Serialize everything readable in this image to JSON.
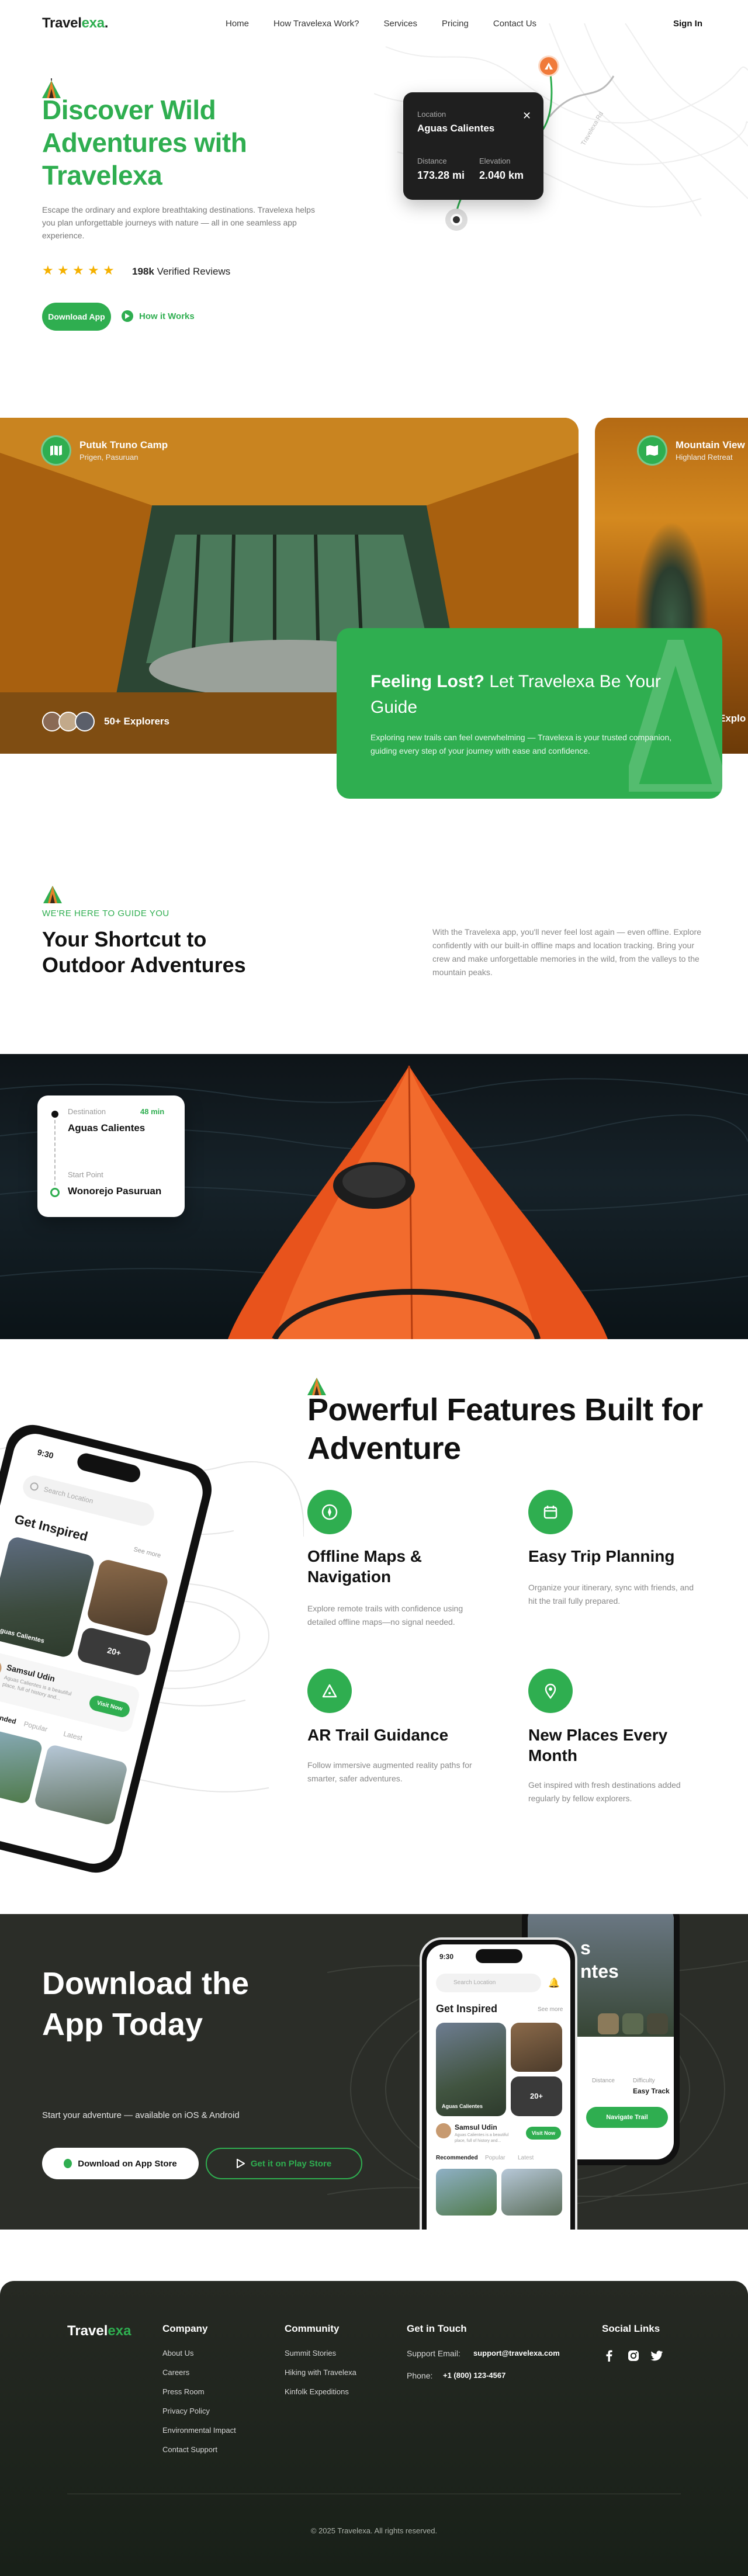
{
  "brand": {
    "name_a": "Travel",
    "name_b": "exa",
    "name_dot": "."
  },
  "nav": {
    "links": [
      "Home",
      "How Travelexa Work?",
      "Services",
      "Pricing",
      "Contact Us"
    ],
    "signin": "Sign In"
  },
  "hero": {
    "title": "Discover Wild Adventures with Travelexa",
    "description": "Escape the ordinary and explore breathtaking destinations. Travelexa helps you plan unforgettable journeys with nature — all in one seamless app experience.",
    "rating_stars": 5,
    "reviews_count": "198k",
    "reviews_label": "Verified Reviews",
    "download_btn": "Download App",
    "how_btn": "How it Works",
    "location_card": {
      "location_label": "Location",
      "location_value": "Aguas Calientes",
      "distance_label": "Distance",
      "distance_value": "173.28 mi",
      "elevation_label": "Elevation",
      "elevation_value": "2.040 km"
    },
    "map_road_label": "Travelexa Rd"
  },
  "gallery": {
    "cards": [
      {
        "title": "Putuk Truno Camp",
        "subtitle": "Prigen, Pasuruan"
      },
      {
        "title": "Mountain View",
        "subtitle": "Highland Retreat"
      }
    ],
    "explorers": "50+ Explorers",
    "explorers_side": "Explo",
    "lost": {
      "title_bold": "Feeling Lost?",
      "title_rest": "Let Travelexa Be Your Guide",
      "description": "Exploring new trails can feel overwhelming — Travelexa is your trusted companion, guiding every step of your journey with ease and confidence."
    }
  },
  "shortcut": {
    "tag": "WE'RE HERE TO GUIDE YOU",
    "title": "Your Shortcut to Outdoor Adventures",
    "description": "With the Travelexa app, you'll never feel lost again — even offline. Explore confidently with our built-in offline maps and location tracking. Bring your crew and make unforgettable memories in the wild, from the valleys to the mountain peaks."
  },
  "route": {
    "destination_label": "Destination",
    "destination_value": "Aguas Calientes",
    "time": "48 min",
    "start_label": "Start Point",
    "start_value": "Wonorejo Pasuruan"
  },
  "features": {
    "title": "Powerful Features Built for Adventure",
    "items": [
      {
        "title": "Offline Maps & Navigation",
        "description": "Explore remote trails with confidence using detailed offline maps—no signal needed.",
        "icon": "compass-icon"
      },
      {
        "title": "Easy Trip Planning",
        "description": "Organize your itinerary, sync with friends, and hit the trail fully prepared.",
        "icon": "calendar-icon"
      },
      {
        "title": "AR Trail Guidance",
        "description": "Follow immersive augmented reality paths for smarter, safer adventures.",
        "icon": "triangle-icon"
      },
      {
        "title": "New Places Every Month",
        "description": "Get inspired with fresh destinations added regularly by fellow explorers.",
        "icon": "map-pin-icon"
      }
    ]
  },
  "phone_app": {
    "time": "9:30",
    "search_placeholder": "Search Location",
    "heading": "Get Inspired",
    "see_more": "See more",
    "card1": "Aguas Calientes",
    "card_count": "20+",
    "user_name": "Samsul Udin",
    "user_desc": "Aguas Calientes is a beautiful place, full of history and...",
    "visit_btn": "Visit Now",
    "tabs": [
      "Recommended",
      "Popular",
      "Latest"
    ]
  },
  "phone_back": {
    "title_a": "s",
    "title_b": "ntes",
    "item_a": "Distance",
    "item_b": "Difficulty",
    "val_b": "Easy Track",
    "nav_btn": "Navigate Trail"
  },
  "download": {
    "title": "Download the App Today",
    "subtitle": "Start your adventure — available on iOS & Android",
    "appstore": "Download on App Store",
    "playstore": "Get it on Play Store"
  },
  "footer": {
    "company": {
      "heading": "Company",
      "links": [
        "About Us",
        "Careers",
        "Press Room",
        "Privacy Policy",
        "Environmental Impact",
        "Contact Support"
      ]
    },
    "community": {
      "heading": "Community",
      "links": [
        "Summit Stories",
        "Hiking with Travelexa",
        "Kinfolk Expeditions"
      ]
    },
    "contact": {
      "heading": "Get in Touch",
      "email_label": "Support Email:",
      "email_value": "support@travelexa.com",
      "phone_label": "Phone:",
      "phone_value": "+1 (800) 123-4567"
    },
    "social": {
      "heading": "Social Links",
      "icons": [
        "facebook-icon",
        "instagram-icon",
        "twitter-icon"
      ]
    },
    "copyright": "© 2025 Travelexa. All rights reserved."
  },
  "colors": {
    "accent": "#2fae50",
    "dark": "#2b2d28",
    "star": "#f5b100"
  }
}
